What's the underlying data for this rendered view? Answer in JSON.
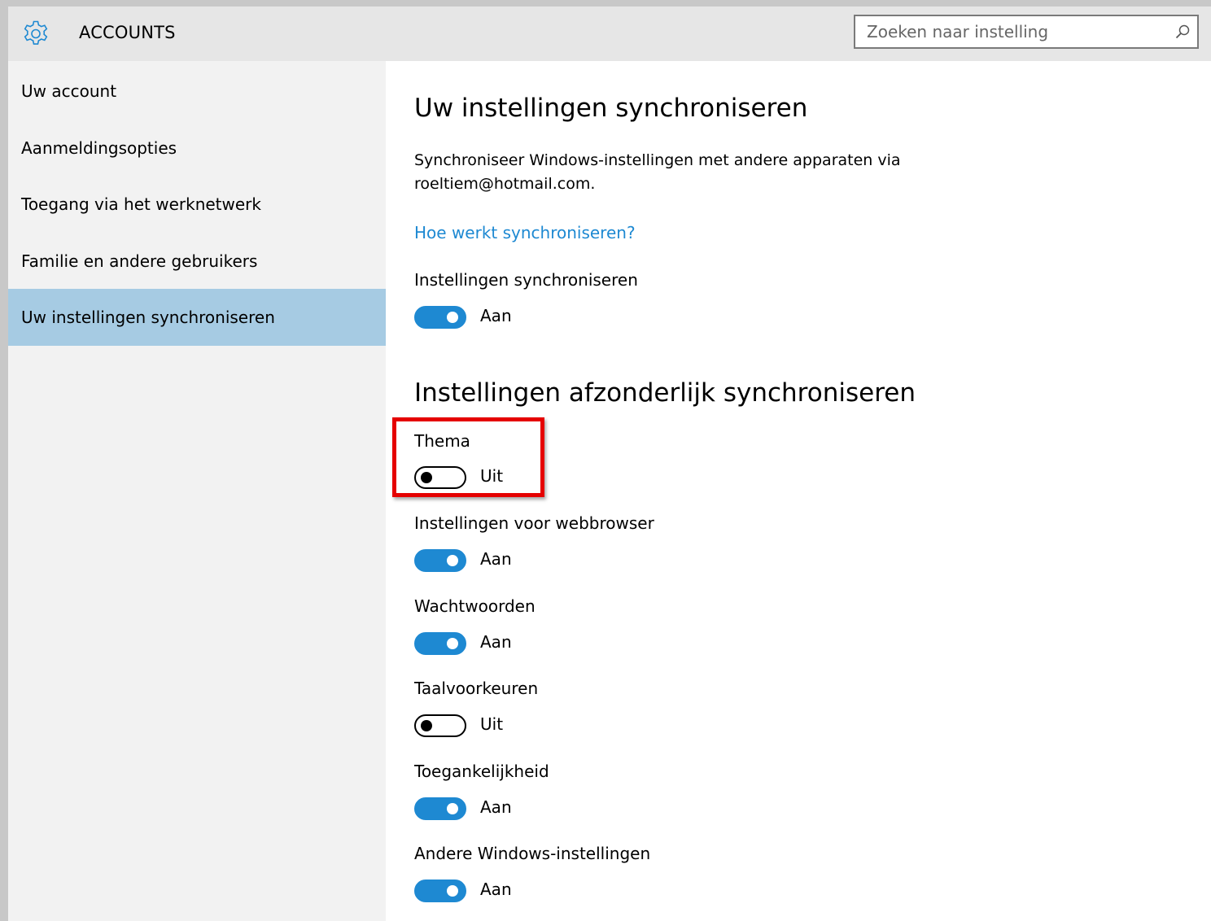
{
  "header": {
    "title": "ACCOUNTS",
    "icon": "gear-icon",
    "search_placeholder": "Zoeken naar instelling",
    "search_icon": "search-icon"
  },
  "sidebar": {
    "items": [
      {
        "label": "Uw account",
        "selected": false
      },
      {
        "label": "Aanmeldingsopties",
        "selected": false
      },
      {
        "label": "Toegang via het werknetwerk",
        "selected": false
      },
      {
        "label": "Familie en andere gebruikers",
        "selected": false
      },
      {
        "label": "Uw instellingen synchroniseren",
        "selected": true
      }
    ]
  },
  "main": {
    "title": "Uw instellingen synchroniseren",
    "description_line1": "Synchroniseer Windows-instellingen met andere apparaten via",
    "description_line2": "roeltiem@hotmail.com.",
    "help_link": "Hoe werkt synchroniseren?",
    "sync_setting": {
      "label": "Instellingen synchroniseren",
      "state": "Aan",
      "on": true
    },
    "section_title": "Instellingen afzonderlijk synchroniseren",
    "settings": [
      {
        "label": "Thema",
        "state": "Uit",
        "on": false,
        "highlighted": true
      },
      {
        "label": "Instellingen voor webbrowser",
        "state": "Aan",
        "on": true
      },
      {
        "label": "Wachtwoorden",
        "state": "Aan",
        "on": true
      },
      {
        "label": "Taalvoorkeuren",
        "state": "Uit",
        "on": false
      },
      {
        "label": "Toegankelijkheid",
        "state": "Aan",
        "on": true
      },
      {
        "label": "Andere Windows-instellingen",
        "state": "Aan",
        "on": true
      }
    ]
  },
  "colors": {
    "accent": "#1e89d2",
    "sidebar_selected": "#a6cbe3",
    "highlight": "#e50000"
  }
}
